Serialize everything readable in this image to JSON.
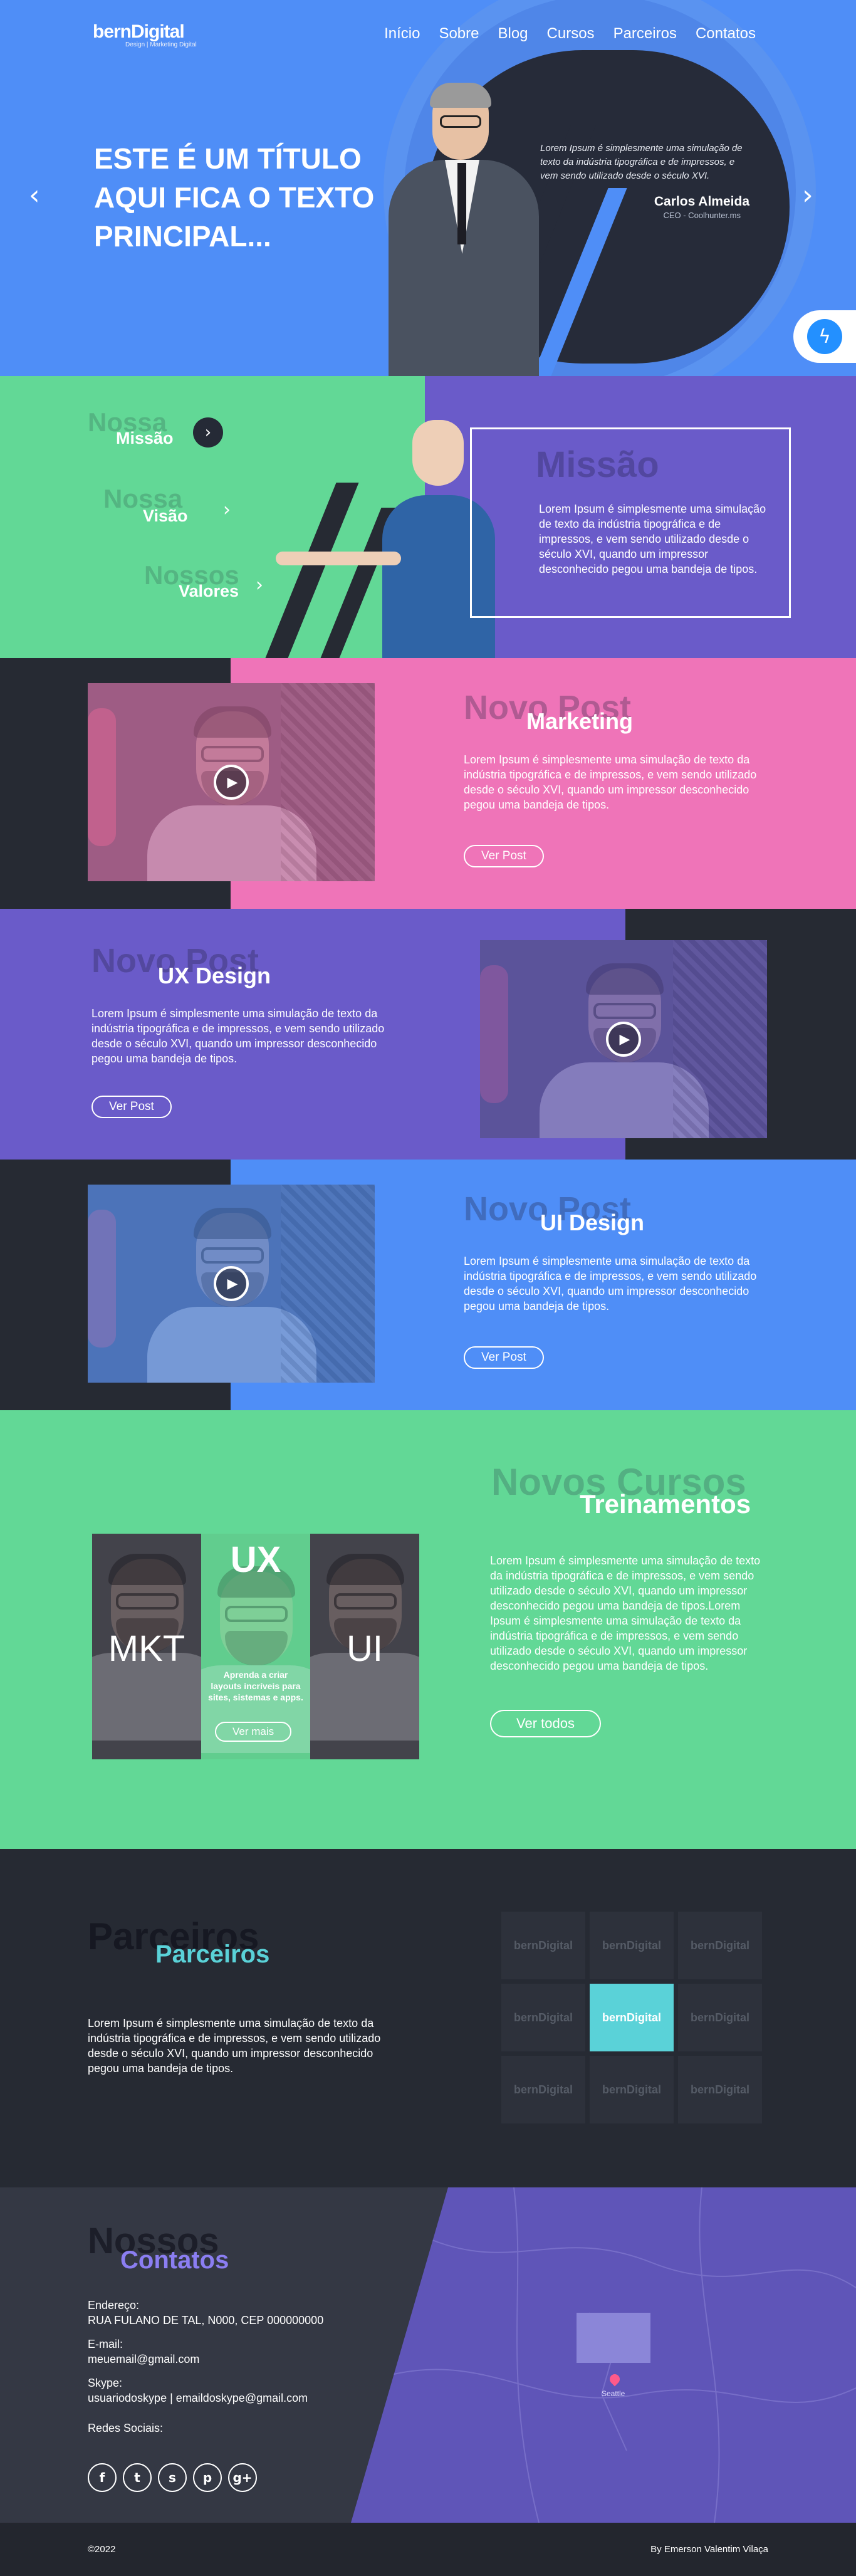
{
  "colors": {
    "blue": "#4f8ef7",
    "green": "#62d896",
    "purple": "#6a5bc9",
    "pink": "#ef74b8",
    "dark": "#262a33",
    "teal": "#5ad2d8",
    "lavender": "#8b7ef2"
  },
  "header": {
    "logo_text": "bernDigital",
    "logo_tagline": "Design | Marketing Digital",
    "nav": [
      "Início",
      "Sobre",
      "Blog",
      "Cursos",
      "Parceiros",
      "Contatos"
    ]
  },
  "hero": {
    "title": "ESTE É UM TÍTULO AQUI FICA O TEXTO PRINCIPAL...",
    "quote": "Lorem Ipsum é simplesmente uma simulação de texto da indústria tipográfica e de impressos, e vem sendo utilizado desde o século XVI.",
    "person_name": "Carlos Almeida",
    "person_role": "CEO - Coolhunter.ms",
    "prev_icon": "chevron-left-icon",
    "next_icon": "chevron-right-icon",
    "messenger_icon": "messenger-icon"
  },
  "mission": {
    "items": [
      {
        "ghost": "Nossa",
        "label": "Missão"
      },
      {
        "ghost": "Nossa",
        "label": "Visão"
      },
      {
        "ghost": "Nossos",
        "label": "Valores"
      }
    ],
    "box_title": "Missão",
    "box_text": "Lorem Ipsum é simplesmente uma simulação de texto da indústria tipográfica e de impressos, e vem sendo utilizado desde o século XVI, quando um impressor desconhecido pegou uma bandeja de tipos."
  },
  "posts": [
    {
      "ghost": "Novo Post",
      "title": "Marketing",
      "text": "Lorem Ipsum é simplesmente uma simulação de texto da indústria tipográfica e de impressos, e vem sendo utilizado desde o século XVI, quando um impressor desconhecido pegou uma bandeja de tipos.",
      "button": "Ver Post"
    },
    {
      "ghost": "Novo Post",
      "title": "UX Design",
      "text": "Lorem Ipsum é simplesmente uma simulação de texto da indústria tipográfica e de impressos, e vem sendo utilizado desde o século XVI, quando um impressor desconhecido pegou uma bandeja de tipos.",
      "button": "Ver Post"
    },
    {
      "ghost": "Novo Post",
      "title": "UI Design",
      "text": "Lorem Ipsum é simplesmente uma simulação de texto da indústria tipográfica e de impressos, e vem sendo utilizado desde o século XVI, quando um impressor desconhecido pegou uma bandeja de tipos.",
      "button": "Ver Post"
    }
  ],
  "courses": {
    "ghost": "Novos Cursos",
    "title": "Treinamentos",
    "text": "Lorem Ipsum é simplesmente uma simulação de texto da indústria tipográfica e de impressos, e vem sendo utilizado desde o século XVI, quando um impressor desconhecido pegou uma bandeja de tipos.Lorem Ipsum é simplesmente uma simulação de texto da indústria tipográfica e de impressos, e vem sendo utilizado desde o século XVI, quando um impressor desconhecido pegou uma bandeja de tipos.",
    "button": "Ver todos",
    "cards": [
      {
        "label": "MKT"
      },
      {
        "label": "UX",
        "desc": "Aprenda a criar layouts incríveis para sites, sistemas e apps.",
        "button": "Ver mais"
      },
      {
        "label": "UI"
      }
    ]
  },
  "partners": {
    "ghost": "Parceiros",
    "title": "Parceiros",
    "text": "Lorem Ipsum é simplesmente uma simulação de texto da indústria tipográfica e de impressos, e vem sendo utilizado desde o século XVI, quando um impressor desconhecido pegou uma bandeja de tipos.",
    "logos": [
      "bernDigital",
      "bernDigital",
      "bernDigital",
      "bernDigital",
      "bernDigital",
      "bernDigital",
      "bernDigital",
      "bernDigital",
      "bernDigital"
    ]
  },
  "contact": {
    "ghost": "Nossos",
    "title": "Contatos",
    "address_label": "Endereço:",
    "address": "RUA FULANO DE TAL, N000, CEP 000000000",
    "email_label": "E-mail:",
    "email": "meuemail@gmail.com",
    "skype_label": "Skype:",
    "skype": "usuariodoskype | emaildoskype@gmail.com",
    "social_label": "Redes Sociais:",
    "social": [
      "f",
      "t",
      "s",
      "p",
      "g+"
    ],
    "map_city": "Seattle"
  },
  "footer": {
    "copyright": "©2022",
    "credit": "By Emerson Valentim Vilaça"
  }
}
